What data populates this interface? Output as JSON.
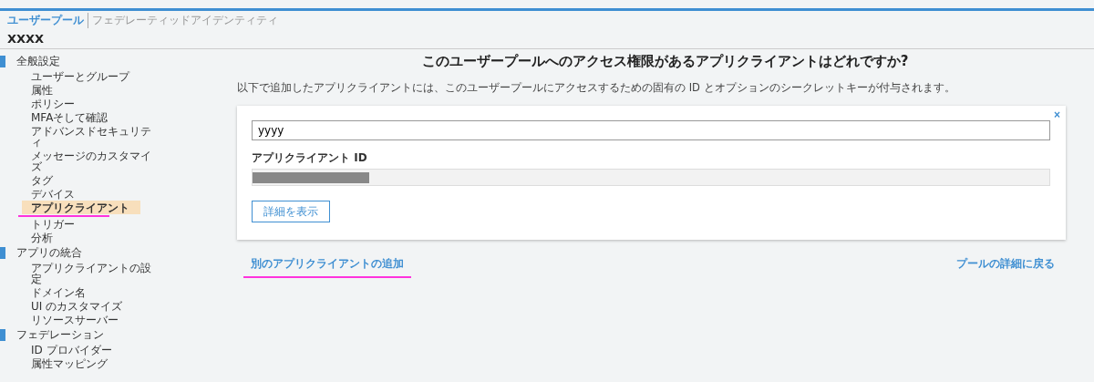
{
  "tabs": [
    {
      "label": "ユーザープール",
      "selected": true
    },
    {
      "label": "フェデレーティッドアイデンティティ",
      "selected": false
    }
  ],
  "pool_name": "XXXX",
  "sidebar": {
    "sections": [
      {
        "label": "全般設定",
        "children": [
          {
            "label": "ユーザーとグループ",
            "selected": false,
            "annotated": false
          },
          {
            "label": "属性",
            "selected": false,
            "annotated": false
          },
          {
            "label": "ポリシー",
            "selected": false,
            "annotated": false
          },
          {
            "label": "MFAそして確認",
            "selected": false,
            "annotated": false
          },
          {
            "label": "アドバンスドセキュリティ",
            "selected": false,
            "annotated": false
          },
          {
            "label": "メッセージのカスタマイズ",
            "selected": false,
            "annotated": false
          },
          {
            "label": "タグ",
            "selected": false,
            "annotated": false
          },
          {
            "label": "デバイス",
            "selected": false,
            "annotated": false
          },
          {
            "label": "アプリクライアント",
            "selected": true,
            "annotated": true
          },
          {
            "label": "トリガー",
            "selected": false,
            "annotated": false
          },
          {
            "label": "分析",
            "selected": false,
            "annotated": false
          }
        ]
      },
      {
        "label": "アプリの統合",
        "children": [
          {
            "label": "アプリクライアントの設定",
            "selected": false,
            "annotated": false
          },
          {
            "label": "ドメイン名",
            "selected": false,
            "annotated": false
          },
          {
            "label": "UI のカスタマイズ",
            "selected": false,
            "annotated": false
          },
          {
            "label": "リソースサーバー",
            "selected": false,
            "annotated": false
          }
        ]
      },
      {
        "label": "フェデレーション",
        "children": [
          {
            "label": "ID プロバイダー",
            "selected": false,
            "annotated": false
          },
          {
            "label": "属性マッピング",
            "selected": false,
            "annotated": false
          }
        ]
      }
    ]
  },
  "main": {
    "heading": "このユーザープールへのアクセス権限があるアプリクライアントはどれですか?",
    "description": "以下で追加したアプリクライアントには、このユーザープールにアクセスするための固有の ID とオプションのシークレットキーが付与されます。",
    "client_card": {
      "close": "×",
      "name_value": "yyyy",
      "id_label": "アプリクライアント ID",
      "details_button": "詳細を表示"
    },
    "add_link": {
      "label": "別のアプリクライアントの追加",
      "annotated": true
    },
    "back_link": "プールの詳細に戻る"
  }
}
